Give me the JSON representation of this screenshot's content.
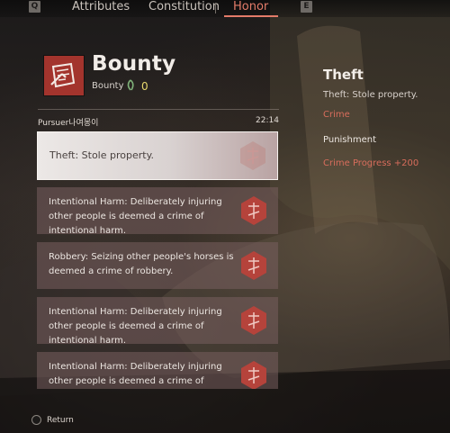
{
  "tabs": {
    "left_key": "Q",
    "right_key": "E",
    "items": [
      "Attributes",
      "Constitution",
      "Honor"
    ],
    "active": "Honor"
  },
  "bounty": {
    "title": "Bounty",
    "subtitle": "Bounty",
    "count": "0"
  },
  "pursuer": {
    "label": "Pursuer나여몽이",
    "timer": "22:14"
  },
  "crimes": [
    {
      "text": "Theft: Stole property.",
      "selected": true
    },
    {
      "text": "Intentional Harm: Deliberately injuring other people is deemed a crime of intentional harm.",
      "selected": false
    },
    {
      "text": "Robbery: Seizing other people's horses is deemed a crime of robbery.",
      "selected": false
    },
    {
      "text": "Intentional Harm: Deliberately injuring other people is deemed a crime of intentional harm.",
      "selected": false
    },
    {
      "text": "Intentional Harm: Deliberately injuring other people is deemed a crime of intentional harm.",
      "selected": false
    }
  ],
  "detail": {
    "title": "Theft",
    "description": "Theft: Stole property.",
    "type": "Crime",
    "punishment_label": "Punishment",
    "punishment_value": "Crime Progress +200"
  },
  "footer": {
    "return_label": "Return"
  },
  "colors": {
    "accent": "#e37b69",
    "crime_red": "#d86d5c",
    "bounty_count": "#e8d86e",
    "badge_red": "#b5433b"
  },
  "icons": {
    "bounty": "broken-scroll-icon",
    "leaf": "leaf-icon",
    "badge": "wanted-seal-icon",
    "return": "return-button-icon"
  }
}
